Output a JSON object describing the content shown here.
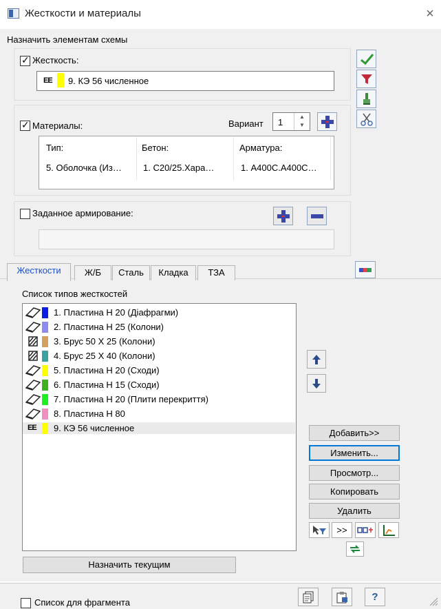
{
  "window": {
    "title": "Жесткости и материалы",
    "close": "×"
  },
  "assign": {
    "group_label": "Назначить элементам схемы",
    "stiffness_label": "Жесткость:",
    "stiffness_value": "9. КЭ 56 численное",
    "stiffness_icon_text": "EE",
    "materials_label": "Материалы:",
    "variant_label": "Вариант",
    "variant_value": "1",
    "columns": [
      "Тип:",
      "Бетон:",
      "Арматура:"
    ],
    "row": [
      "5. Оболочка (Из…",
      "1. С20/25.Хара…",
      "1. А400С.А400С…"
    ],
    "reinforcement_label": "Заданное армирование:"
  },
  "tabs": [
    "Жесткости",
    "Ж/Б",
    "Сталь",
    "Кладка",
    "ТЗА"
  ],
  "list": {
    "title": "Список типов жесткостей",
    "items": [
      {
        "label": "1. Пластина  Н 20 (Діафрагми)",
        "color": "#0a1ee6",
        "icon": "plate"
      },
      {
        "label": "2. Пластина  Н 25 (Колони)",
        "color": "#8c8cf0",
        "icon": "plate"
      },
      {
        "label": "3. Брус 50 Х 25 (Колони)",
        "color": "#d2a060",
        "icon": "bar"
      },
      {
        "label": "4. Брус 25 Х 40 (Колони)",
        "color": "#3aa0a0",
        "icon": "bar"
      },
      {
        "label": "5. Пластина  Н 20 (Сходи)",
        "color": "#ffff00",
        "icon": "plate"
      },
      {
        "label": "6. Пластина  Н 15 (Сходи)",
        "color": "#40b020",
        "icon": "plate"
      },
      {
        "label": "7. Пластина  Н 20 (Плити перекриття)",
        "color": "#20ee20",
        "icon": "plate"
      },
      {
        "label": "8. Пластина  Н 80",
        "color": "#f090c0",
        "icon": "plate"
      },
      {
        "label": "9. КЭ 56 численное",
        "color": "#ffff00",
        "icon": "fe",
        "icon_text": "EE"
      }
    ]
  },
  "buttons": {
    "add": "Добавить>>",
    "edit": "Изменить...",
    "view": "Просмотр...",
    "copy": "Копировать",
    "delete": "Удалить",
    "forward": ">>",
    "assign_current": "Назначить текущим"
  },
  "footer": {
    "fragment_label": "Список для фрагмента",
    "help": "?"
  }
}
